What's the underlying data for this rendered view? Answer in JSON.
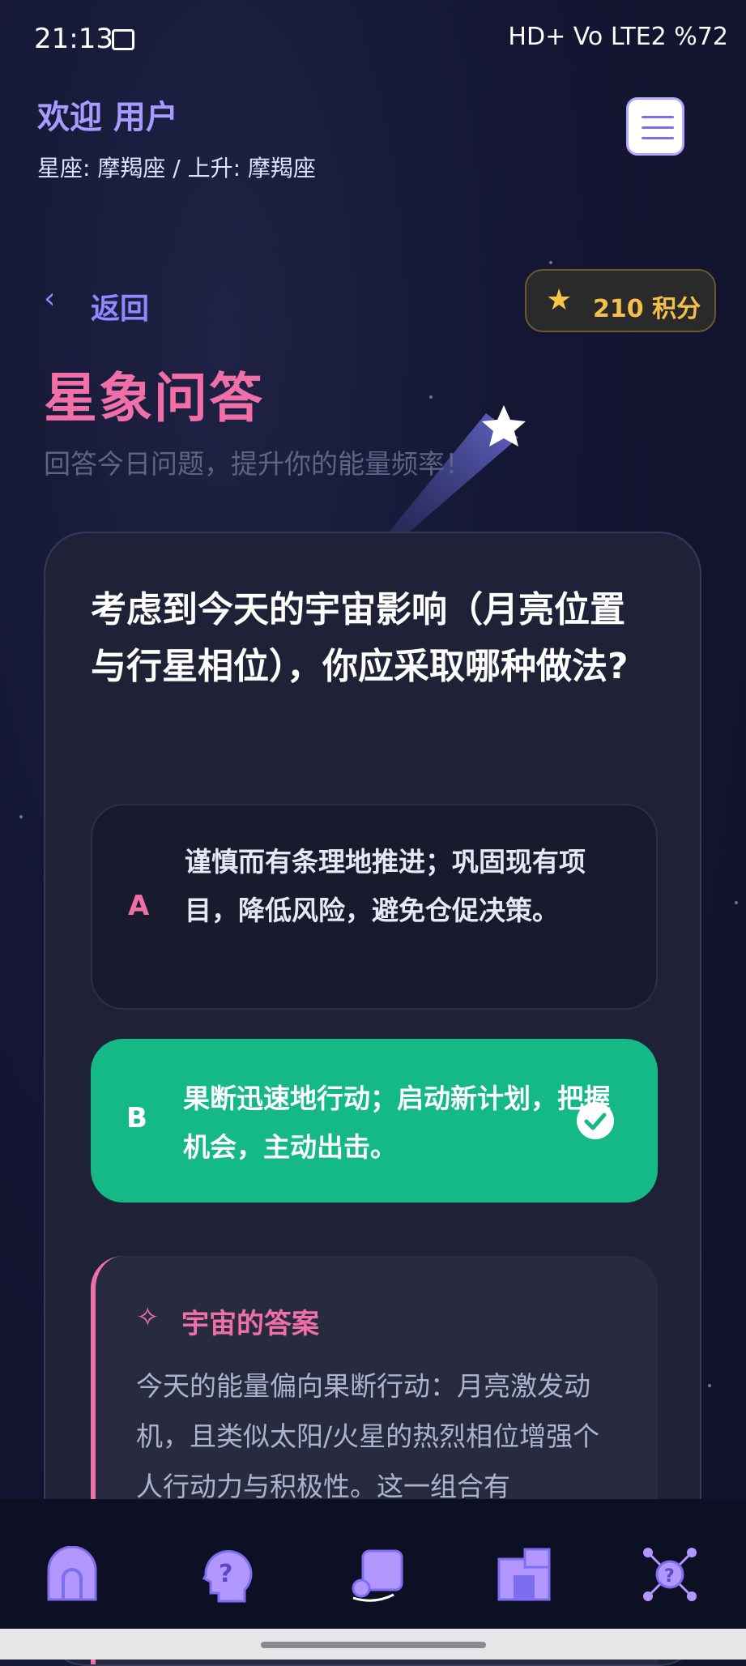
{
  "status_bar": {
    "time": "21:13",
    "right": "HD+ Vo LTE2 %72"
  },
  "header": {
    "welcome": "欢迎 用户",
    "zodiac": "星座: 摩羯座 / 上升: 摩羯座",
    "menu_icon": "hamburger-menu-icon"
  },
  "nav_back": {
    "arrow": "‹",
    "label": "返回"
  },
  "points": {
    "star": "★",
    "label": "210 积分"
  },
  "page": {
    "title": "星象问答",
    "subtitle": "回答今日问题，提升你的能量频率！"
  },
  "quiz": {
    "question": "考虑到今天的宇宙影响（月亮位置与行星相位），你应采取哪种做法?",
    "options": [
      {
        "letter": "A",
        "text": "谨慎而有条理地推进；巩固现有项目，降低风险，避免仓促决策。",
        "selected": false
      },
      {
        "letter": "B",
        "text": "果断迅速地行动；启动新计划，把握机会，主动出击。",
        "selected": true
      }
    ],
    "answer": {
      "icon": "✧",
      "title": "宇宙的答案",
      "text": "今天的能量偏向果断行动：月亮激发动机，且类似太阳/火星的热烈相位增强个人行动力与积极性。这一组合有"
    }
  },
  "bottom_nav": {
    "items": [
      "home-icon",
      "question-head-icon",
      "horoscope-icon",
      "shop-icon",
      "network-icon"
    ]
  },
  "colors": {
    "accent": "#ef6fa6",
    "success": "#14b985",
    "purple": "#8f88ff",
    "gold": "#f5c04a"
  }
}
